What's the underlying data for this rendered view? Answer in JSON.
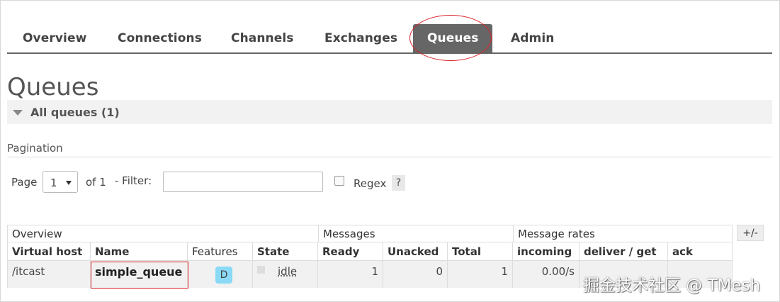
{
  "nav": {
    "items": [
      {
        "label": "Overview"
      },
      {
        "label": "Connections"
      },
      {
        "label": "Channels"
      },
      {
        "label": "Exchanges"
      },
      {
        "label": "Queues"
      },
      {
        "label": "Admin"
      }
    ],
    "active": "Queues"
  },
  "page": {
    "title": "Queues"
  },
  "section": {
    "label": "All queues (1)"
  },
  "pagination": {
    "label": "Pagination",
    "page_label": "Page",
    "page_value": "1",
    "of_label": "of 1",
    "filter_label": "- Filter:",
    "filter_value": "",
    "regex_label": "Regex",
    "regex_checked": false,
    "help_label": "?"
  },
  "table": {
    "groups": [
      "Overview",
      "Messages",
      "Message rates"
    ],
    "plusminus": "+/-",
    "columns": [
      "Virtual host",
      "Name",
      "Features",
      "State",
      "Ready",
      "Unacked",
      "Total",
      "incoming",
      "deliver / get",
      "ack"
    ],
    "rows": [
      {
        "vhost": "/itcast",
        "name": "simple_queue",
        "features": "D",
        "state": "idle",
        "ready": "1",
        "unacked": "0",
        "total": "1",
        "incoming": "0.00/s",
        "deliver_get": "",
        "ack": ""
      }
    ]
  },
  "colors": {
    "nav_active_bg": "#666666",
    "feature_badge": "#8ad9f7",
    "annotation": "#d9262b"
  },
  "watermark": "掘金技术社区 @ TMesh"
}
